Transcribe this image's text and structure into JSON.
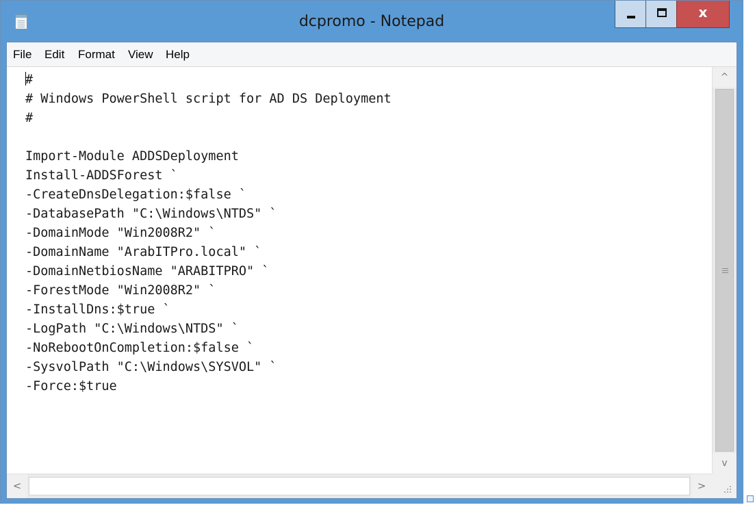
{
  "window": {
    "title": "dcpromo - Notepad",
    "close_glyph": "x",
    "accent_color": "#5b9bd5",
    "close_color": "#c75050"
  },
  "menu": {
    "items": [
      "File",
      "Edit",
      "Format",
      "View",
      "Help"
    ]
  },
  "editor": {
    "lines": [
      "#",
      "# Windows PowerShell script for AD DS Deployment",
      "#",
      "",
      "Import-Module ADDSDeployment",
      "Install-ADDSForest `",
      "-CreateDnsDelegation:$false `",
      "-DatabasePath \"C:\\Windows\\NTDS\" `",
      "-DomainMode \"Win2008R2\" `",
      "-DomainName \"ArabITPro.local\" `",
      "-DomainNetbiosName \"ARABITPRO\" `",
      "-ForestMode \"Win2008R2\" `",
      "-InstallDns:$true `",
      "-LogPath \"C:\\Windows\\NTDS\" `",
      "-NoRebootOnCompletion:$false `",
      "-SysvolPath \"C:\\Windows\\SYSVOL\" `",
      "-Force:$true"
    ]
  },
  "scrollbars": {
    "up_glyph": "^",
    "down_glyph": "v",
    "left_glyph": "<",
    "right_glyph": ">",
    "grip_glyph": "≡"
  },
  "icons": {
    "app": "notepad-icon",
    "minimize": "minimize-icon",
    "maximize": "maximize-icon",
    "close": "close-icon"
  }
}
